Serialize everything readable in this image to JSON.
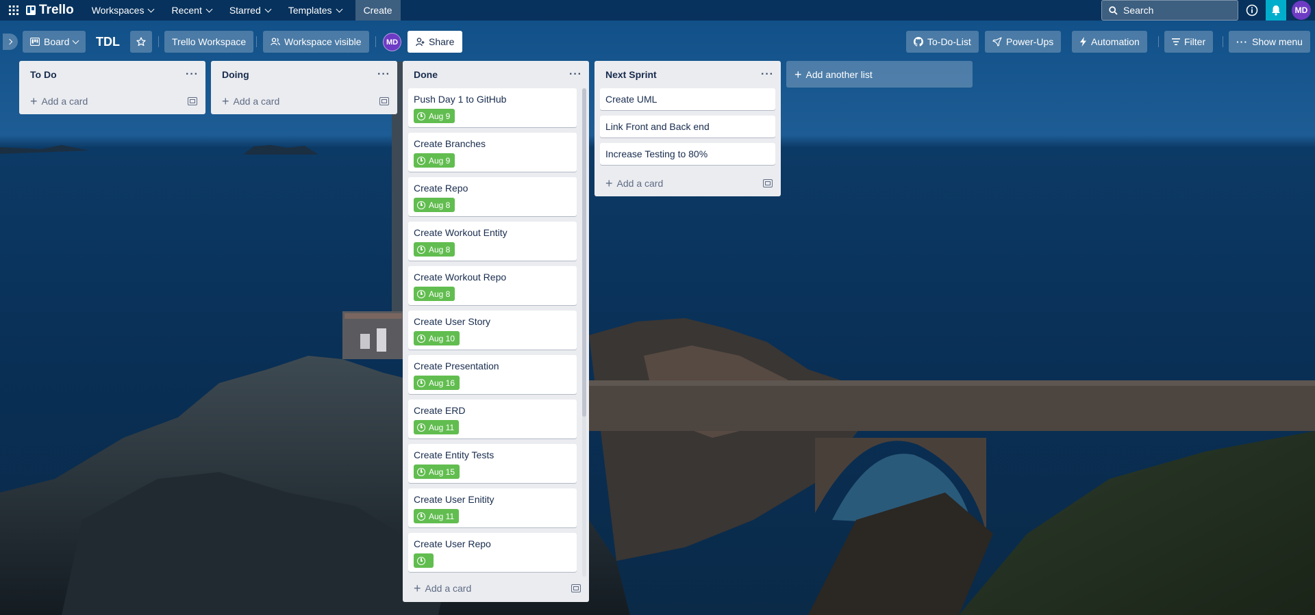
{
  "topnav": {
    "logo": "Trello",
    "menus": [
      "Workspaces",
      "Recent",
      "Starred",
      "Templates"
    ],
    "create": "Create",
    "search_placeholder": "Search",
    "avatar": "MD"
  },
  "board": {
    "view": "Board",
    "title": "TDL",
    "workspace": "Trello Workspace",
    "visibility": "Workspace visible",
    "member": "MD",
    "share": "Share",
    "right": {
      "github": "To-Do-List",
      "powerups": "Power-Ups",
      "automation": "Automation",
      "filter": "Filter",
      "menu": "Show menu"
    }
  },
  "lists": [
    {
      "title": "To Do",
      "add": "Add a card"
    },
    {
      "title": "Doing",
      "add": "Add a card"
    },
    {
      "title": "Done",
      "add": "Add a card",
      "cards": [
        {
          "title": "Push Day 1 to GitHub",
          "due": "Aug 9"
        },
        {
          "title": "Create Branches",
          "due": "Aug 9"
        },
        {
          "title": "Create Repo",
          "due": "Aug 8"
        },
        {
          "title": "Create Workout Entity",
          "due": "Aug 8"
        },
        {
          "title": "Create Workout Repo",
          "due": "Aug 8"
        },
        {
          "title": "Create User Story",
          "due": "Aug 10"
        },
        {
          "title": "Create Presentation",
          "due": "Aug 16"
        },
        {
          "title": "Create ERD",
          "due": "Aug 11"
        },
        {
          "title": "Create Entity Tests",
          "due": "Aug 15"
        },
        {
          "title": "Create User Enitity",
          "due": "Aug 11"
        },
        {
          "title": "Create User Repo",
          "due": ""
        }
      ]
    },
    {
      "title": "Next Sprint",
      "add": "Add a card",
      "cards": [
        {
          "title": "Create UML"
        },
        {
          "title": "Link Front and Back end"
        },
        {
          "title": "Increase Testing to 80%"
        }
      ]
    }
  ],
  "add_list": "Add another list",
  "colors": {
    "nav_bg": "#062c54",
    "list_bg": "#ebecf0",
    "due_badge": "#61bd4f",
    "bell": "#00aecc",
    "avatar": "#6d3bc4"
  }
}
